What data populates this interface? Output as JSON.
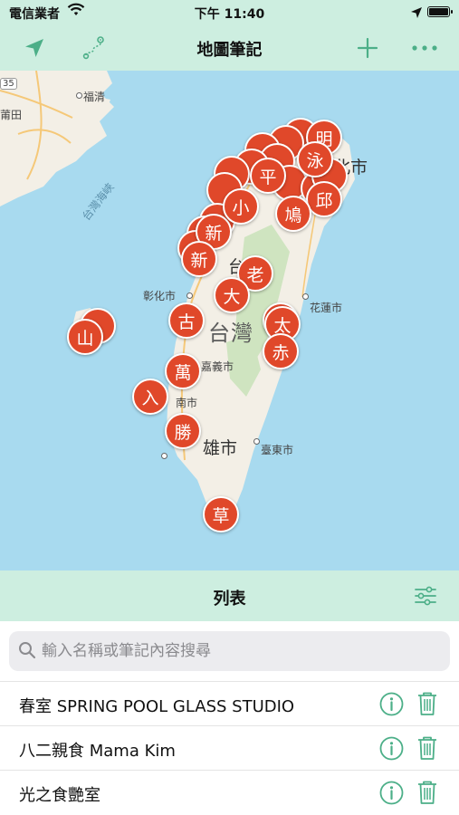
{
  "status_bar": {
    "carrier": "電信業者",
    "time": "下午 11:40"
  },
  "nav": {
    "title": "地圖筆記",
    "left_icons": [
      "location-arrow-icon",
      "route-icon"
    ],
    "right_icons": [
      "plus-icon",
      "more-icon"
    ]
  },
  "map": {
    "labels": {
      "fuqing": "福清",
      "putian": "莆田",
      "road35": "35",
      "strait": "台灣海峽",
      "taipei_frag": "北市",
      "taizhong_frag": "台中",
      "changhua": "彰化市",
      "hualien": "花蓮市",
      "taiwan": "台灣",
      "chiayi_frag": "嘉義市",
      "tainan_frag": "南市",
      "kaohsiung_frag": "雄市",
      "taitung": "臺東市"
    },
    "pins": [
      "明",
      "新",
      "平",
      "泳",
      "邱",
      "鳩",
      "小",
      "新",
      "老",
      "大",
      "古",
      "山",
      "太",
      "赤",
      "萬",
      "入",
      "勝",
      "草"
    ]
  },
  "list_header": {
    "title": "列表"
  },
  "search": {
    "placeholder": "輸入名稱或筆記內容搜尋",
    "value": ""
  },
  "items": [
    {
      "name": "春室 SPRING POOL GLASS STUDIO"
    },
    {
      "name": "八二親食 Mama Kim"
    },
    {
      "name": "光之食艷室"
    }
  ],
  "colors": {
    "accent": "#4caf88",
    "bar": "#cdeee0",
    "pin": "#e0482a",
    "sea": "#a8daef",
    "land": "#f3efe6"
  }
}
